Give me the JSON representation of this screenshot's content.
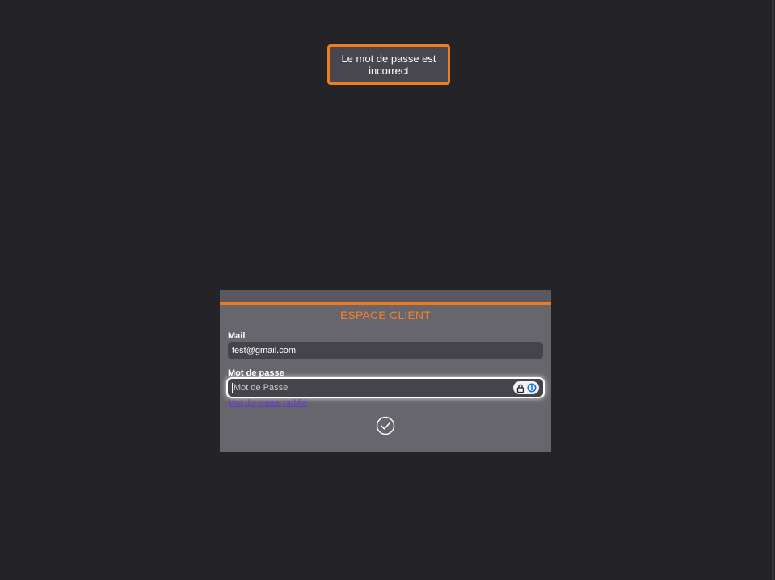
{
  "toast": {
    "message": "Le mot de passe est incorrect",
    "border_color": "#f07d1f"
  },
  "login": {
    "title": "ESPACE CLIENT",
    "accent_color": "#ef7a1a",
    "mail_label": "Mail",
    "mail_value": "test@gmail.com",
    "password_label": "Mot de passe",
    "password_placeholder": "Mot de Passe",
    "password_value": "",
    "forgot_link": "Mot de passe oublié",
    "submit_icon": "check-circle-icon",
    "password_tools_icons": [
      "lock-icon",
      "password-manager-icon"
    ]
  }
}
